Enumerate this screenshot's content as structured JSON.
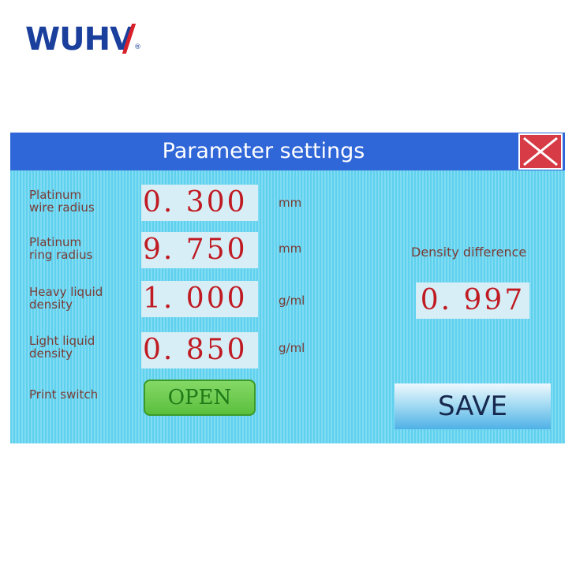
{
  "brand": {
    "name": "WUH",
    "last_letter": "V",
    "registered_mark": "®"
  },
  "window": {
    "title": "Parameter settings",
    "close_icon": "close-x-icon"
  },
  "parameters": [
    {
      "label_line1": "Platinum",
      "label_line2": "wire radius",
      "value": "0. 300",
      "unit": "mm"
    },
    {
      "label_line1": "Platinum",
      "label_line2": "ring radius",
      "value": "9. 750",
      "unit": "mm"
    },
    {
      "label_line1": "Heavy liquid",
      "label_line2": "density",
      "value": "1. 000",
      "unit": "g/ml"
    },
    {
      "label_line1": "Light liquid",
      "label_line2": "density",
      "value": "0. 850",
      "unit": "g/ml"
    }
  ],
  "density_difference": {
    "label": "Density difference",
    "value": "0. 997"
  },
  "print_switch": {
    "label": "Print switch",
    "state_label": "OPEN"
  },
  "save_button": {
    "label": "SAVE"
  },
  "colors": {
    "screen_background": "#6ad5f0",
    "titlebar": "#2f66d8",
    "close_button": "#d73b46",
    "value_text": "#c01a22",
    "label_text": "#7a3b35",
    "toggle_on": "#5bbf3d",
    "brand_blue": "#1b3f9c",
    "brand_red": "#d8202a"
  }
}
